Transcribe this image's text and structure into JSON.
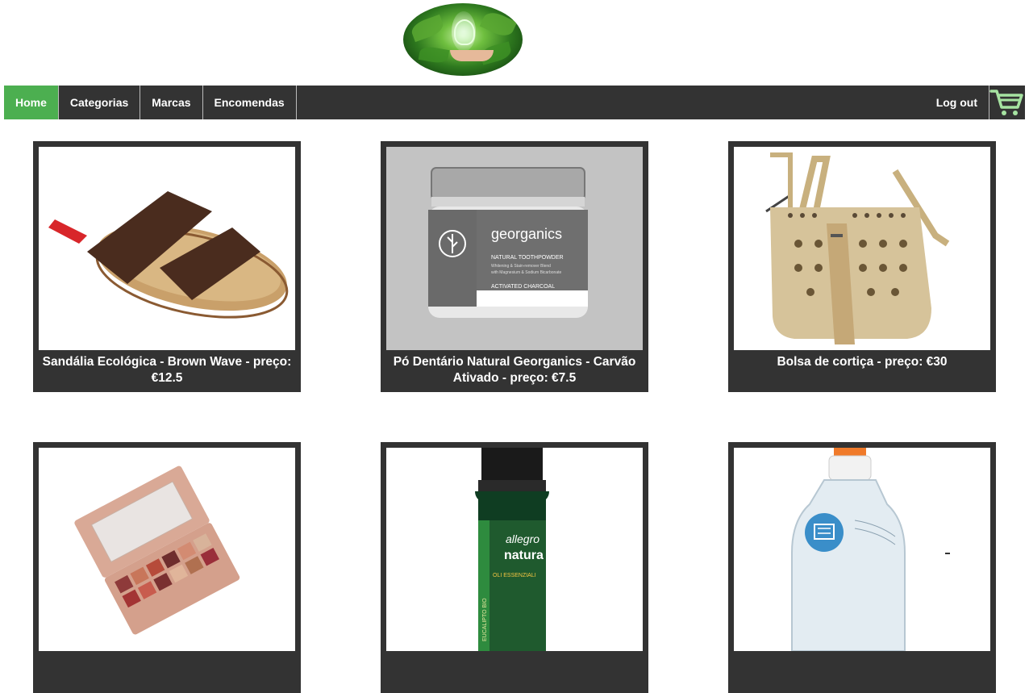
{
  "logo": {
    "alt": "logo",
    "icon": "lightbulb-hand-logo"
  },
  "nav": {
    "items": [
      {
        "label": "Home",
        "active": true
      },
      {
        "label": "Categorias",
        "active": false
      },
      {
        "label": "Marcas",
        "active": false
      },
      {
        "label": "Encomendas",
        "active": false
      }
    ],
    "logout_label": "Log out",
    "cart_icon": "shopping-cart-icon",
    "active_color": "#4CAF50",
    "bar_color": "#333333",
    "cart_color": "#a6e3a1"
  },
  "products": [
    {
      "caption": "Sandália Ecológica - Brown Wave - preço: €12.5",
      "image": "sandal"
    },
    {
      "caption": "Pó Dentário Natural Georganics - Carvão Ativado - preço: €7.5",
      "image": "toothpowder-jar",
      "jar_label": {
        "brand": "georganics",
        "line1": "NATURAL TOOTHPOWDER",
        "line2": "Whitening & Stain-remover Blend",
        "line3": "with Magnesium & Sodium Bicarbonate",
        "line4": "ACTIVATED CHARCOAL"
      }
    },
    {
      "caption": "Bolsa de cortiça - preço: €30",
      "image": "cork-bag"
    },
    {
      "caption": "",
      "image": "eyeshadow-palette"
    },
    {
      "caption": "",
      "image": "essential-oil-bottle",
      "bottle_label": {
        "brand1": "allegro",
        "brand2": "natura",
        "side": "EUCALIPTO BIO",
        "sub": "OLI ESSENZIALI"
      }
    },
    {
      "caption": "",
      "image": "detergent-bottle"
    }
  ]
}
